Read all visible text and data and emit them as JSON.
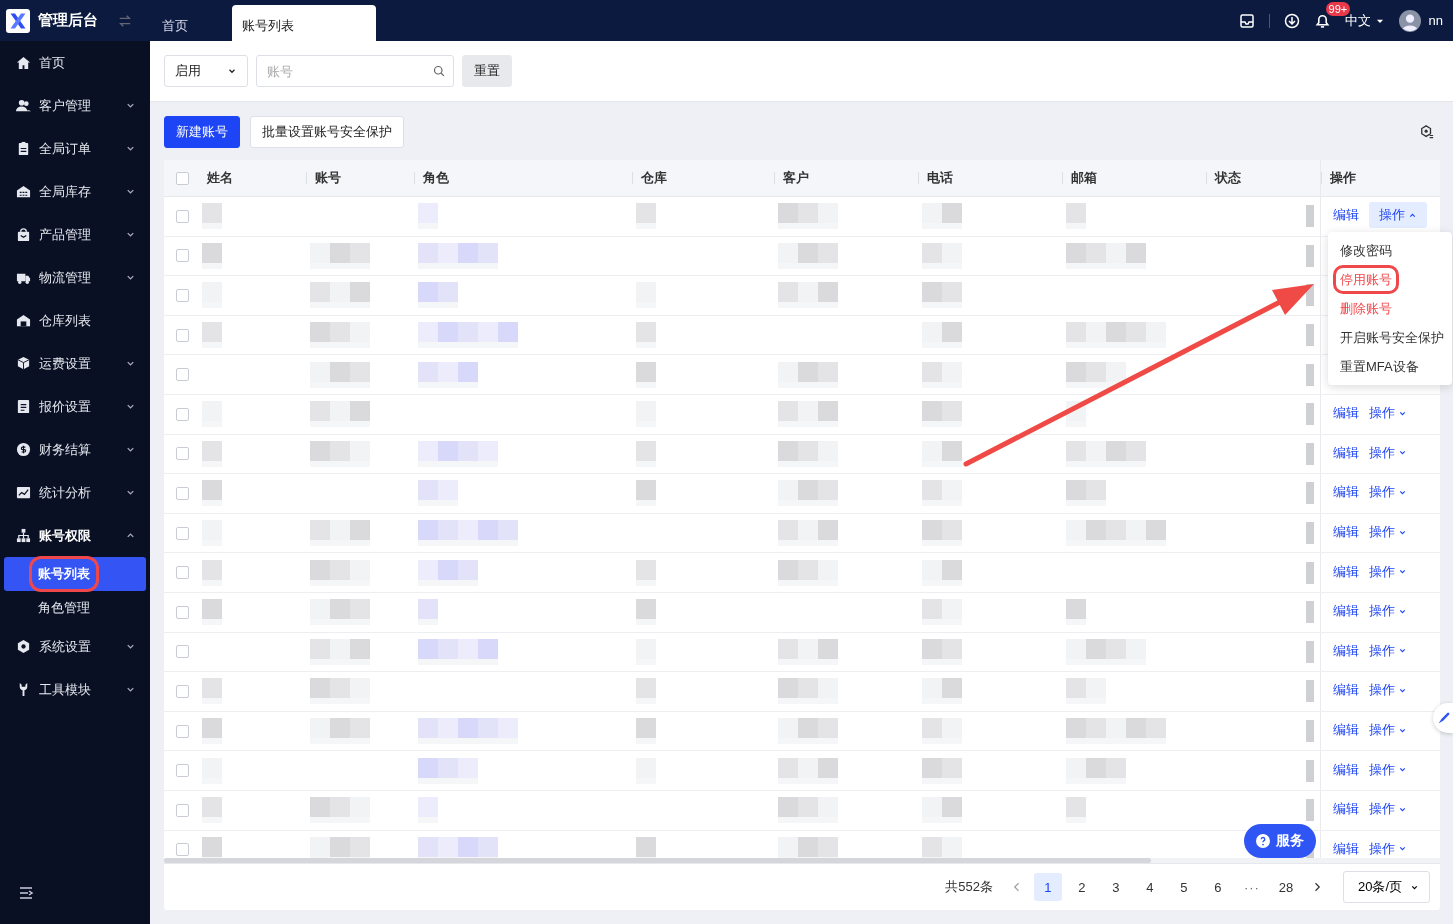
{
  "app": {
    "title": "管理后台"
  },
  "tabs": [
    {
      "label": "首页",
      "selected": false
    },
    {
      "label": "账号列表",
      "selected": true
    }
  ],
  "header": {
    "notification_count": "99+",
    "language": "中文",
    "user": "nn"
  },
  "sidebar": {
    "items": [
      {
        "label": "首页",
        "expandable": false,
        "expanded": false
      },
      {
        "label": "客户管理",
        "expandable": true,
        "expanded": false
      },
      {
        "label": "全局订单",
        "expandable": true,
        "expanded": false
      },
      {
        "label": "全局库存",
        "expandable": true,
        "expanded": false
      },
      {
        "label": "产品管理",
        "expandable": true,
        "expanded": false
      },
      {
        "label": "物流管理",
        "expandable": true,
        "expanded": false
      },
      {
        "label": "仓库列表",
        "expandable": false,
        "expanded": false
      },
      {
        "label": "运费设置",
        "expandable": true,
        "expanded": false
      },
      {
        "label": "报价设置",
        "expandable": true,
        "expanded": false
      },
      {
        "label": "财务结算",
        "expandable": true,
        "expanded": false
      },
      {
        "label": "统计分析",
        "expandable": true,
        "expanded": false
      },
      {
        "label": "账号权限",
        "expandable": true,
        "expanded": true,
        "children": [
          {
            "label": "账号列表",
            "selected": true,
            "highlighted": true
          },
          {
            "label": "角色管理",
            "selected": false,
            "highlighted": false
          }
        ]
      },
      {
        "label": "系统设置",
        "expandable": true,
        "expanded": false
      },
      {
        "label": "工具模块",
        "expandable": true,
        "expanded": false
      }
    ]
  },
  "filters": {
    "status": "启用",
    "search_placeholder": "账号",
    "reset": "重置"
  },
  "toolbar": {
    "buttons": [
      {
        "label": "新建账号",
        "kind": "primary"
      },
      {
        "label": "批量设置账号安全保护",
        "kind": "default"
      }
    ]
  },
  "table": {
    "all_checked": false,
    "columns": [
      "姓名",
      "账号",
      "角色",
      "仓库",
      "客户",
      "电话",
      "邮箱",
      "状态",
      "操作"
    ],
    "rows": [
      {
        "checked": false,
        "edit": "编辑",
        "more": "操作",
        "expanded": true
      },
      {
        "checked": false
      },
      {
        "checked": false
      },
      {
        "checked": false
      },
      {
        "checked": false
      },
      {
        "checked": false,
        "edit": "编辑",
        "more": "操作",
        "expanded": false
      },
      {
        "checked": false,
        "edit": "编辑",
        "more": "操作",
        "expanded": false
      },
      {
        "checked": false,
        "edit": "编辑",
        "more": "操作",
        "expanded": false
      },
      {
        "checked": false,
        "edit": "编辑",
        "more": "操作",
        "expanded": false
      },
      {
        "checked": false,
        "edit": "编辑",
        "more": "操作",
        "expanded": false
      },
      {
        "checked": false,
        "edit": "编辑",
        "more": "操作",
        "expanded": false
      },
      {
        "checked": false,
        "edit": "编辑",
        "more": "操作",
        "expanded": false
      },
      {
        "checked": false,
        "edit": "编辑",
        "more": "操作",
        "expanded": false
      },
      {
        "checked": false,
        "edit": "编辑",
        "more": "操作",
        "expanded": false
      },
      {
        "checked": false,
        "edit": "编辑",
        "more": "操作",
        "expanded": false
      },
      {
        "checked": false,
        "edit": "编辑",
        "more": "操作",
        "expanded": false
      },
      {
        "checked": false,
        "edit": "编辑",
        "more": "操作",
        "expanded": false
      }
    ]
  },
  "action_menu": {
    "items": [
      {
        "label": "修改密码",
        "kind": "normal",
        "highlighted": false
      },
      {
        "label": "停用账号",
        "kind": "danger",
        "highlighted": true
      },
      {
        "label": "删除账号",
        "kind": "danger",
        "highlighted": false
      },
      {
        "label": "开启账号安全保护",
        "kind": "normal",
        "highlighted": false
      },
      {
        "label": "重置MFA设备",
        "kind": "normal",
        "highlighted": false
      }
    ]
  },
  "pagination": {
    "total": "共552条",
    "pages": [
      {
        "label": "1",
        "kind": "page",
        "selected": true
      },
      {
        "label": "2",
        "kind": "page",
        "selected": false
      },
      {
        "label": "3",
        "kind": "page",
        "selected": false
      },
      {
        "label": "4",
        "kind": "page",
        "selected": false
      },
      {
        "label": "5",
        "kind": "page",
        "selected": false
      },
      {
        "label": "6",
        "kind": "page",
        "selected": false
      },
      {
        "label": "···",
        "kind": "ellipsis"
      },
      {
        "label": "28",
        "kind": "page",
        "selected": false
      }
    ],
    "page_size": "20条/页"
  },
  "service_button": {
    "label": "服务"
  },
  "annotation": {
    "arrow": true
  }
}
